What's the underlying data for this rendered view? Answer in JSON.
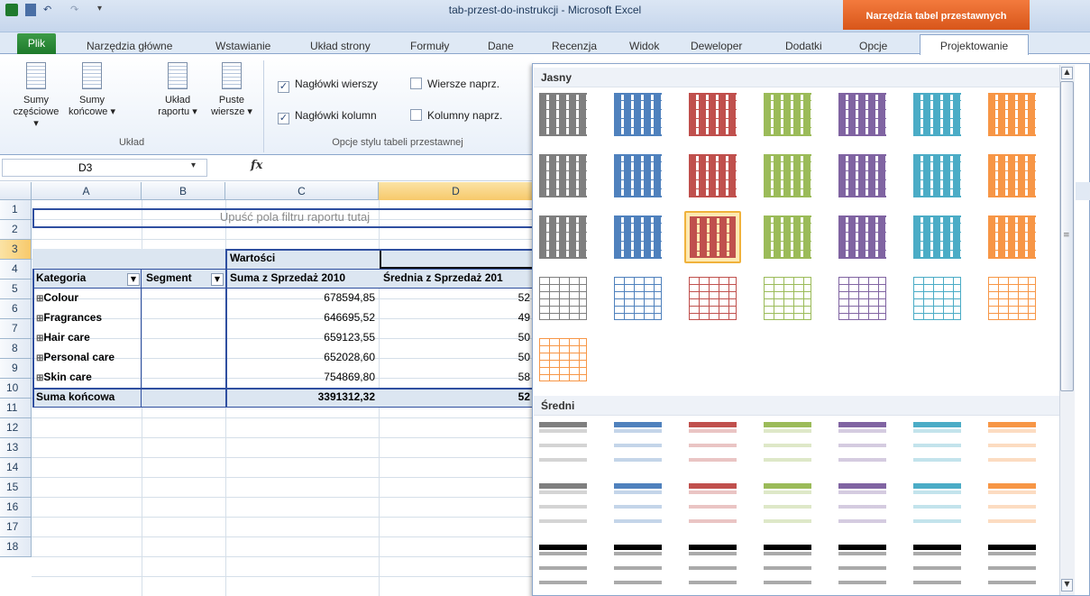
{
  "window": {
    "title": "tab-przest-do-instrukcji - Microsoft Excel",
    "context_tab_group": "Narzędzia tabel przestawnych"
  },
  "tabs": {
    "file": "Plik",
    "items": [
      "Narzędzia główne",
      "Wstawianie",
      "Układ strony",
      "Formuły",
      "Dane",
      "Recenzja",
      "Widok",
      "Deweloper",
      "Dodatki",
      "Opcje",
      "Projektowanie"
    ],
    "active": "Projektowanie"
  },
  "ribbon": {
    "layout_group": {
      "label": "Układ",
      "subtotals": {
        "line1": "Sumy",
        "line2": "częściowe ▾"
      },
      "grand_totals": {
        "line1": "Sumy",
        "line2": "końcowe ▾"
      },
      "report_layout": {
        "line1": "Układ",
        "line2": "raportu ▾"
      },
      "blank_rows": {
        "line1": "Puste",
        "line2": "wiersze ▾"
      }
    },
    "style_options_group": {
      "label": "Opcje stylu tabeli przestawnej",
      "row_headers": {
        "label": "Nagłówki wierszy",
        "checked": true
      },
      "column_headers": {
        "label": "Nagłówki kolumn",
        "checked": true
      },
      "banded_rows": {
        "label": "Wiersze naprz.",
        "checked": false
      },
      "banded_columns": {
        "label": "Kolumny naprz.",
        "checked": false
      }
    }
  },
  "formula_bar": {
    "name_box": "D3",
    "fx": "fx",
    "formula": ""
  },
  "columns": [
    "A",
    "B",
    "C",
    "D"
  ],
  "rows": [
    "1",
    "2",
    "3",
    "4",
    "5",
    "6",
    "7",
    "8",
    "9",
    "10",
    "11",
    "12",
    "13",
    "14",
    "15",
    "16",
    "17",
    "18"
  ],
  "sheet": {
    "filter_drop": "Upuść pola filtru raportu tutaj",
    "values_header": "Wartości",
    "header": {
      "category": "Kategoria",
      "segment": "Segment",
      "sum2010": "Suma z Sprzedaż 2010",
      "avg2010": "Średnia z Sprzedaż 201"
    },
    "data_rows": [
      {
        "category": "Colour",
        "sum": "678594,85",
        "avg": "52"
      },
      {
        "category": "Fragrances",
        "sum": "646695,52",
        "avg": "49"
      },
      {
        "category": "Hair care",
        "sum": "659123,55",
        "avg": "50"
      },
      {
        "category": "Personal care",
        "sum": "652028,60",
        "avg": "50"
      },
      {
        "category": "Skin care",
        "sum": "754869,80",
        "avg": "58"
      }
    ],
    "total": {
      "label": "Suma końcowa",
      "sum": "3391312,32",
      "avg": "52"
    }
  },
  "gallery": {
    "section_light": "Jasny",
    "section_medium": "Średni",
    "light_colors": [
      "#7f7f7f",
      "#4f81bd",
      "#c0504d",
      "#9bbb59",
      "#8064a2",
      "#4bacc6",
      "#f79646"
    ],
    "medium_colors": [
      "#7f7f7f",
      "#4f81bd",
      "#c0504d",
      "#9bbb59",
      "#8064a2",
      "#4bacc6",
      "#f79646"
    ],
    "selected_style": "light-row3-col3"
  },
  "colors": {
    "pivot_border": "#2f4fa0",
    "accent_header": "#dce6f1",
    "context_orange": "#e96a2a"
  }
}
